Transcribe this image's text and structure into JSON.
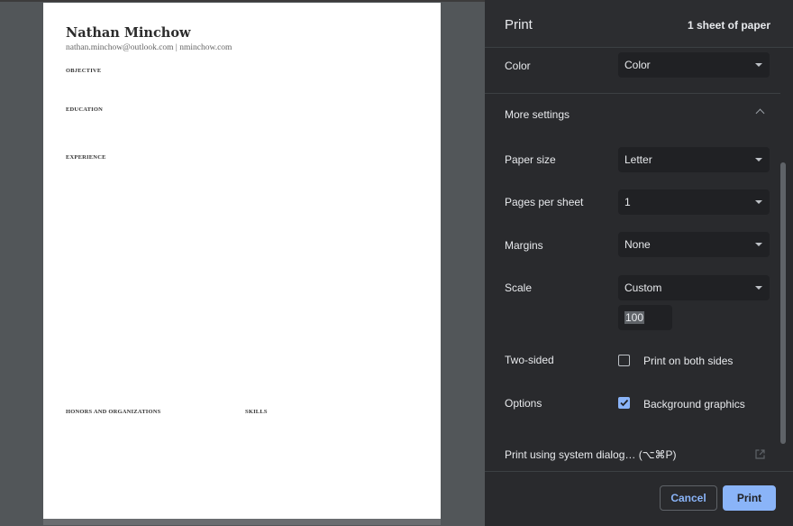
{
  "preview": {
    "document": {
      "name": "Nathan Minchow",
      "contact": "nathan.minchow@outlook.com | nminchow.com",
      "sections": {
        "objective": "OBJECTIVE",
        "education": "EDUCATION",
        "experience": "EXPERIENCE",
        "honors": "HONORS AND ORGANIZATIONS",
        "skills": "SKILLS"
      }
    }
  },
  "panel": {
    "title": "Print",
    "sheet_count": "1 sheet of paper",
    "color": {
      "label": "Color",
      "value": "Color"
    },
    "more_settings": {
      "label": "More settings",
      "expanded": true
    },
    "paper_size": {
      "label": "Paper size",
      "value": "Letter"
    },
    "pages_per_sheet": {
      "label": "Pages per sheet",
      "value": "1"
    },
    "margins": {
      "label": "Margins",
      "value": "None"
    },
    "scale": {
      "label": "Scale",
      "value": "Custom",
      "custom_value": "100"
    },
    "two_sided": {
      "label": "Two-sided",
      "option_label": "Print on both sides",
      "checked": false
    },
    "options": {
      "label": "Options",
      "option_label": "Background graphics",
      "checked": true
    },
    "system_dialog": {
      "label": "Print using system dialog… (⌥⌘P)",
      "icon": "open-in-new-icon"
    },
    "buttons": {
      "cancel": "Cancel",
      "print": "Print"
    }
  },
  "colors": {
    "panel_bg": "#292a2d",
    "field_bg": "#202124",
    "accent": "#8ab4f8",
    "preview_bg": "#525659"
  }
}
